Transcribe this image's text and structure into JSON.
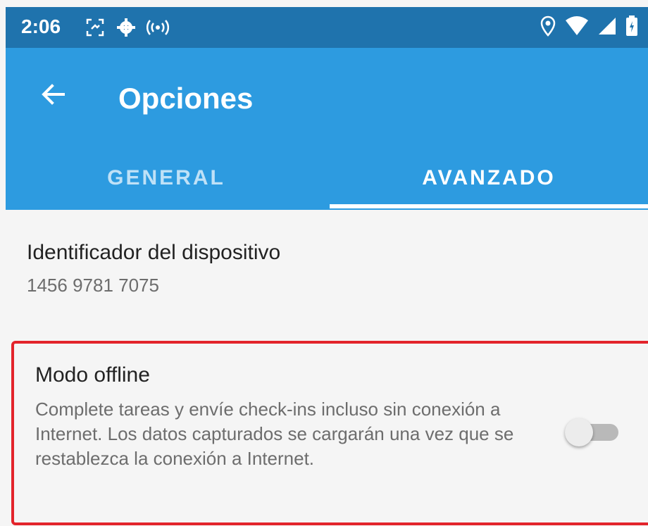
{
  "status_bar": {
    "time": "2:06",
    "icons_left": [
      "screenshot-icon",
      "settings-icon",
      "hotspot-icon"
    ],
    "icons_right": [
      "location-icon",
      "wifi-icon",
      "signal-icon",
      "battery-icon"
    ]
  },
  "app_bar": {
    "title": "Opciones",
    "back_icon": "arrow-back-icon",
    "color": "#2d9be0"
  },
  "tabs": [
    {
      "label": "GENERAL",
      "selected": false
    },
    {
      "label": "AVANZADO",
      "selected": true
    }
  ],
  "device": {
    "title": "Identificador del dispositivo",
    "value": "1456 9781 7075"
  },
  "offline": {
    "title": "Modo offline",
    "description": "Complete tareas y envíe check-ins incluso sin conexión a Internet. Los datos capturados se cargarán una vez que se restablezca la conexión a Internet.",
    "enabled": false,
    "highlight_color": "#e3242b"
  }
}
